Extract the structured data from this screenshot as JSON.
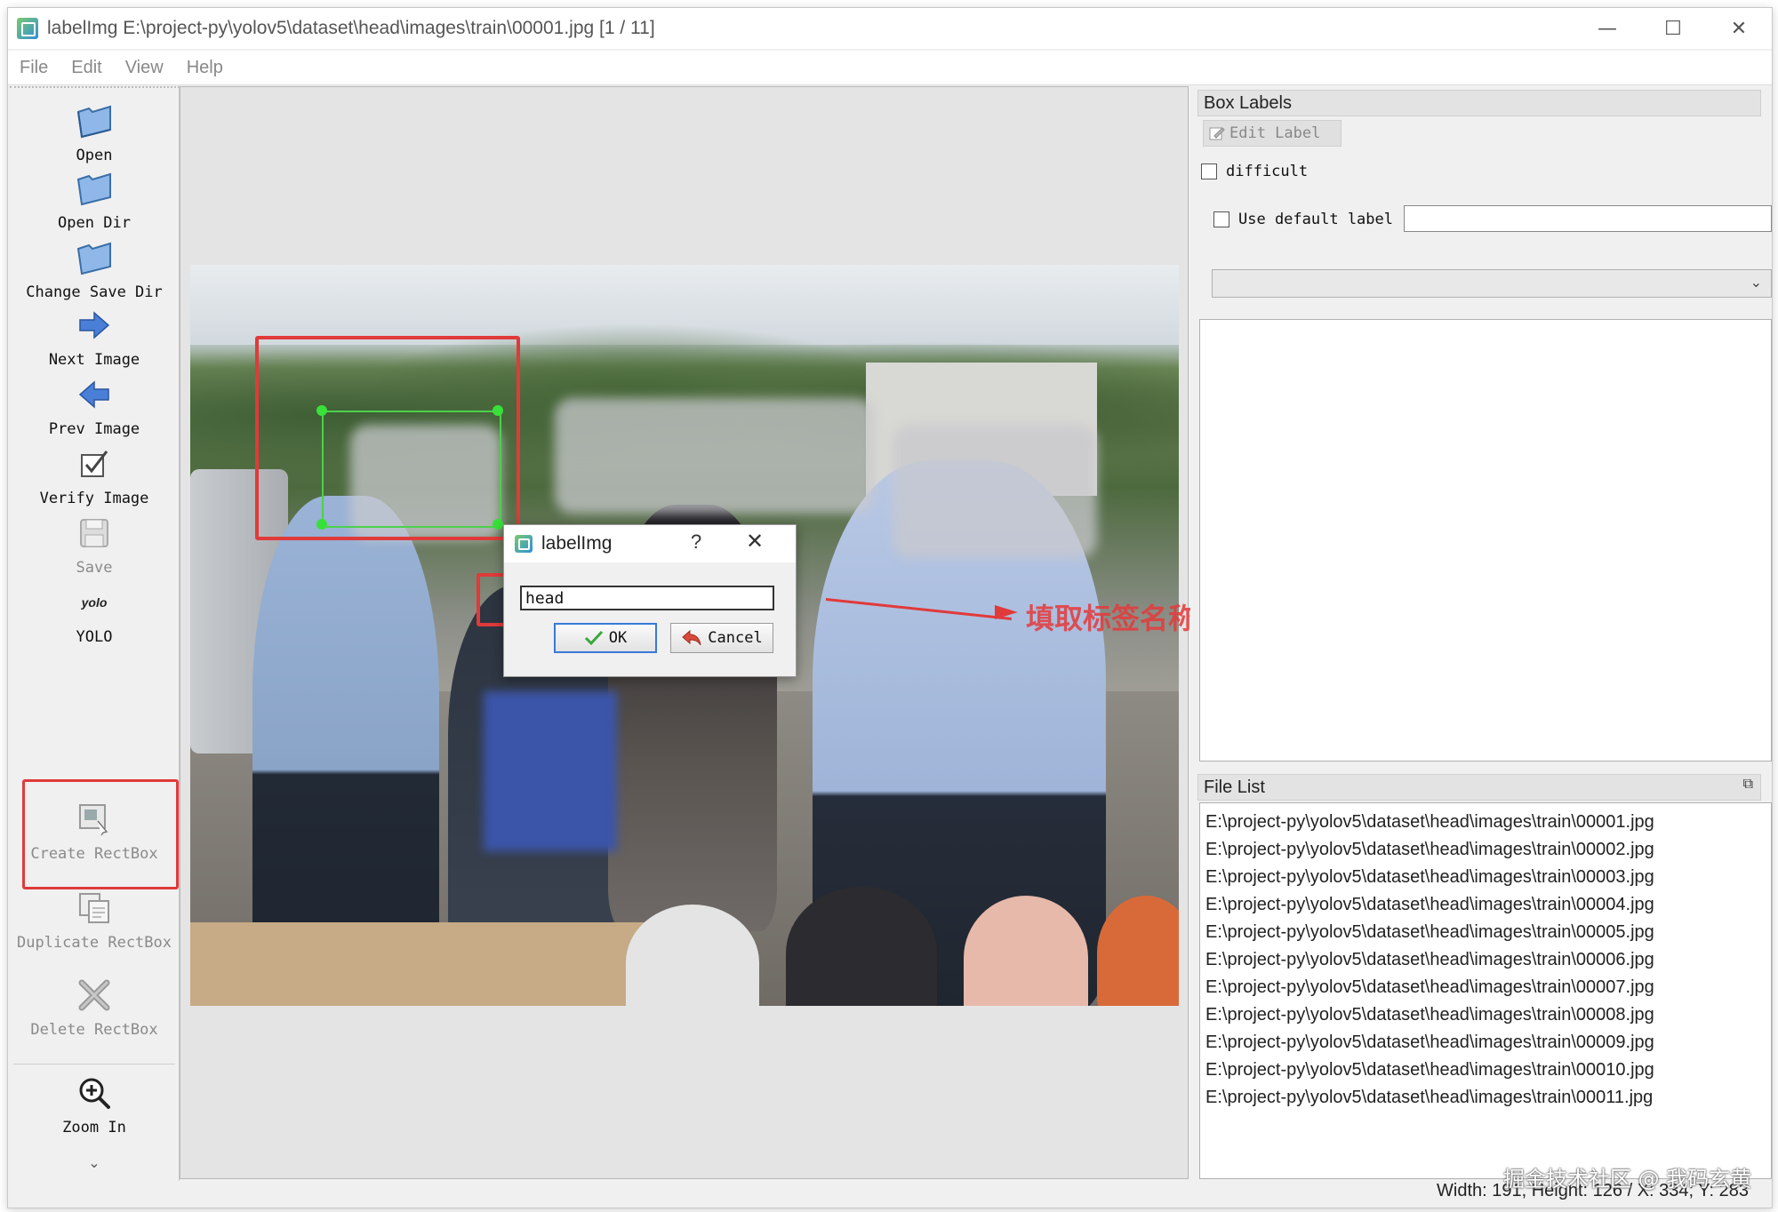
{
  "window": {
    "title": "labelImg E:\\project-py\\yolov5\\dataset\\head\\images\\train\\00001.jpg [1 / 11]",
    "controls": {
      "minimize": "—",
      "maximize": "☐",
      "close": "✕"
    }
  },
  "menu": [
    "File",
    "Edit",
    "View",
    "Help"
  ],
  "toolbar": {
    "open": "Open",
    "open_dir": "Open Dir",
    "change_save_dir": "Change Save Dir",
    "next_image": "Next Image",
    "prev_image": "Prev Image",
    "verify_image": "Verify Image",
    "save": "Save",
    "yolo_icon_text": "yolo",
    "yolo": "YOLO",
    "create_rectbox": "Create RectBox",
    "duplicate_rectbox": "Duplicate RectBox",
    "delete_rectbox": "Delete RectBox",
    "zoom_in": "Zoom In",
    "more": "⌄"
  },
  "dialog": {
    "title": "labelImg",
    "help": "?",
    "close": "✕",
    "input_value": "head",
    "ok": "OK",
    "cancel": "Cancel"
  },
  "annotation": {
    "text": "填取标签名称",
    "color": "#e53a3a"
  },
  "box_labels": {
    "title": "Box Labels",
    "edit_label": "Edit Label",
    "difficult": "difficult",
    "use_default_label": "Use default label",
    "default_label_value": "",
    "combo_value": ""
  },
  "file_list": {
    "title": "File List",
    "items": [
      "E:\\project-py\\yolov5\\dataset\\head\\images\\train\\00001.jpg",
      "E:\\project-py\\yolov5\\dataset\\head\\images\\train\\00002.jpg",
      "E:\\project-py\\yolov5\\dataset\\head\\images\\train\\00003.jpg",
      "E:\\project-py\\yolov5\\dataset\\head\\images\\train\\00004.jpg",
      "E:\\project-py\\yolov5\\dataset\\head\\images\\train\\00005.jpg",
      "E:\\project-py\\yolov5\\dataset\\head\\images\\train\\00006.jpg",
      "E:\\project-py\\yolov5\\dataset\\head\\images\\train\\00007.jpg",
      "E:\\project-py\\yolov5\\dataset\\head\\images\\train\\00008.jpg",
      "E:\\project-py\\yolov5\\dataset\\head\\images\\train\\00009.jpg",
      "E:\\project-py\\yolov5\\dataset\\head\\images\\train\\00010.jpg",
      "E:\\project-py\\yolov5\\dataset\\head\\images\\train\\00011.jpg"
    ]
  },
  "status": "Width: 191, Height: 126 / X: 334; Y: 283",
  "watermark": "掘金技术社区 @ 我码玄黄",
  "colors": {
    "highlight": "#e03a3a",
    "bbox": "#4cd14c",
    "accent": "#3a78d8"
  }
}
